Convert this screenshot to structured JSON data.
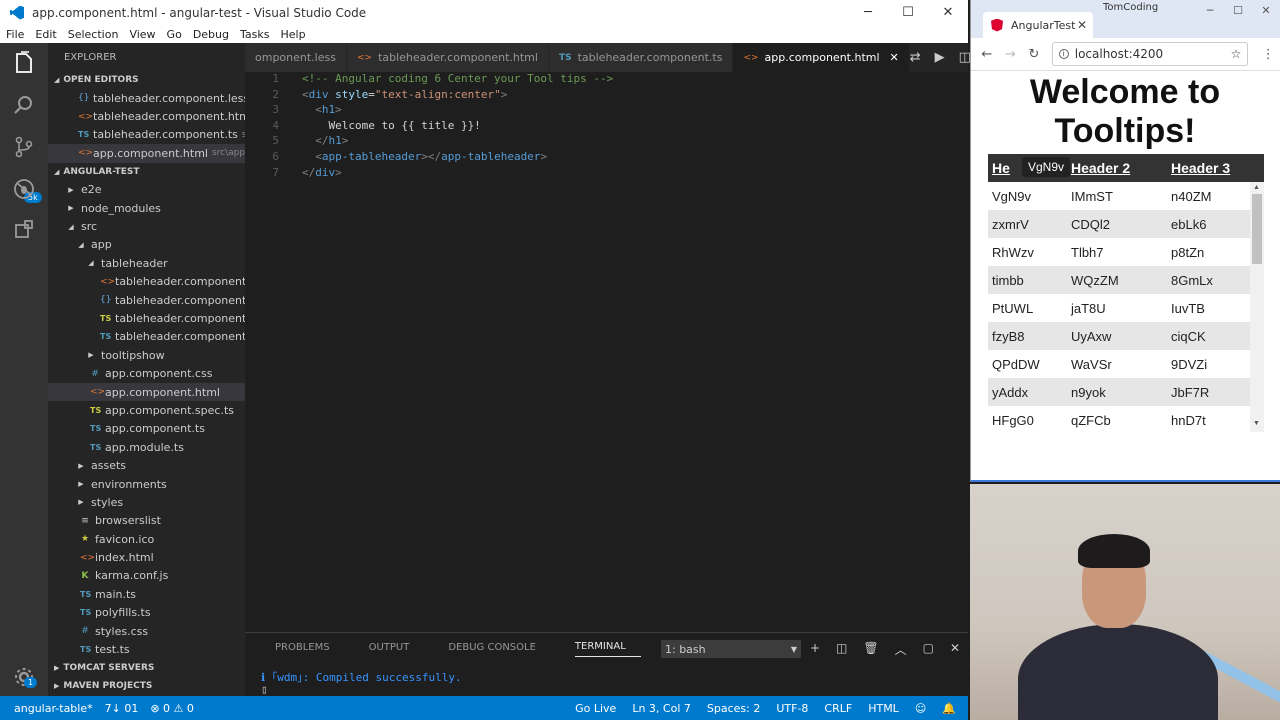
{
  "vscode": {
    "window_title": "app.component.html - angular-test - Visual Studio Code",
    "menu": [
      "File",
      "Edit",
      "Selection",
      "View",
      "Go",
      "Debug",
      "Tasks",
      "Help"
    ],
    "activity_badge": "5k",
    "settings_badge": "1",
    "explorer_title": "EXPLORER",
    "open_editors_label": "OPEN EDITORS",
    "open_editors": [
      {
        "name": "tableheader.component.less",
        "path": "s...",
        "icon": "less-icon"
      },
      {
        "name": "tableheader.component.html",
        "path": "...",
        "icon": "html-icon"
      },
      {
        "name": "tableheader.component.ts",
        "path": "src...",
        "icon": "ts-icon"
      },
      {
        "name": "app.component.html",
        "path": "src\\app",
        "icon": "html-icon"
      }
    ],
    "project_label": "ANGULAR-TEST",
    "tree": [
      {
        "name": "e2e",
        "type": "folder-collapsed"
      },
      {
        "name": "node_modules",
        "type": "folder-collapsed"
      },
      {
        "name": "src",
        "type": "folder-expanded"
      },
      {
        "name": "app",
        "type": "folder-expanded"
      },
      {
        "name": "tableheader",
        "type": "folder-expanded"
      },
      {
        "name": "tableheader.component.html",
        "type": "html"
      },
      {
        "name": "tableheader.component.less",
        "type": "less"
      },
      {
        "name": "tableheader.component.spe...",
        "type": "spec"
      },
      {
        "name": "tableheader.component.ts",
        "type": "ts"
      },
      {
        "name": "tooltipshow",
        "type": "folder-collapsed"
      },
      {
        "name": "app.component.css",
        "type": "css"
      },
      {
        "name": "app.component.html",
        "type": "html"
      },
      {
        "name": "app.component.spec.ts",
        "type": "spec"
      },
      {
        "name": "app.component.ts",
        "type": "ts"
      },
      {
        "name": "app.module.ts",
        "type": "ts"
      },
      {
        "name": "assets",
        "type": "folder-collapsed"
      },
      {
        "name": "environments",
        "type": "folder-collapsed"
      },
      {
        "name": "styles",
        "type": "folder-collapsed"
      },
      {
        "name": "browserslist",
        "type": "plain"
      },
      {
        "name": "favicon.ico",
        "type": "star"
      },
      {
        "name": "index.html",
        "type": "html"
      },
      {
        "name": "karma.conf.js",
        "type": "karma"
      },
      {
        "name": "main.ts",
        "type": "ts"
      },
      {
        "name": "polyfills.ts",
        "type": "ts"
      },
      {
        "name": "styles.css",
        "type": "css"
      },
      {
        "name": "test.ts",
        "type": "ts"
      }
    ],
    "bottom_sections": [
      "TOMCAT SERVERS",
      "MAVEN PROJECTS"
    ],
    "tabs": [
      {
        "label": "omponent.less",
        "icon": ""
      },
      {
        "label": "tableheader.component.html",
        "icon": "<>"
      },
      {
        "label": "tableheader.component.ts",
        "icon": "TS"
      },
      {
        "label": "app.component.html",
        "icon": "<>",
        "active": true
      }
    ],
    "code": [
      {
        "ln": "1",
        "tokens": [
          {
            "t": "<!-- Angular coding 6 Center your Tool tips -->",
            "c": "c-comment"
          }
        ]
      },
      {
        "ln": "2",
        "tokens": [
          {
            "t": "<",
            "c": "c-punct"
          },
          {
            "t": "div",
            "c": "c-tag"
          },
          {
            "t": " style",
            "c": "c-attr"
          },
          {
            "t": "=",
            "c": "c-text"
          },
          {
            "t": "\"text-align:center\"",
            "c": "c-str"
          },
          {
            "t": ">",
            "c": "c-punct"
          }
        ]
      },
      {
        "ln": "3",
        "tokens": [
          {
            "t": "  <",
            "c": "c-punct"
          },
          {
            "t": "h1",
            "c": "c-tag"
          },
          {
            "t": ">",
            "c": "c-punct"
          }
        ]
      },
      {
        "ln": "4",
        "tokens": [
          {
            "t": "    Welcome to {{ title }}!",
            "c": "c-text"
          }
        ]
      },
      {
        "ln": "5",
        "tokens": [
          {
            "t": "  </",
            "c": "c-punct"
          },
          {
            "t": "h1",
            "c": "c-tag"
          },
          {
            "t": ">",
            "c": "c-punct"
          }
        ]
      },
      {
        "ln": "6",
        "tokens": [
          {
            "t": "  <",
            "c": "c-punct"
          },
          {
            "t": "app-tableheader",
            "c": "c-tag"
          },
          {
            "t": "></",
            "c": "c-punct"
          },
          {
            "t": "app-tableheader",
            "c": "c-tag"
          },
          {
            "t": ">",
            "c": "c-punct"
          }
        ]
      },
      {
        "ln": "7",
        "tokens": [
          {
            "t": "</",
            "c": "c-punct"
          },
          {
            "t": "div",
            "c": "c-tag"
          },
          {
            "t": ">",
            "c": "c-punct"
          }
        ]
      }
    ],
    "panel_tabs": [
      "PROBLEMS",
      "OUTPUT",
      "DEBUG CONSOLE",
      "TERMINAL"
    ],
    "terminal_select": "1: bash",
    "terminal_output": "ℹ ｢wdm｣: Compiled successfully.",
    "status": {
      "branch": "angular-table*",
      "sync": "7↓ 01",
      "errors": "⊗ 0 ⚠ 0",
      "go_live": "Go Live",
      "position": "Ln 3, Col 7",
      "spaces": "Spaces: 2",
      "encoding": "UTF-8",
      "eol": "CRLF",
      "language": "HTML"
    }
  },
  "chrome": {
    "tab_title": "AngularTest",
    "profile": "TomCoding",
    "url": "localhost:4200",
    "heading": "Welcome to Tooltips!",
    "headers": [
      "He",
      "Header 2",
      "Header 3"
    ],
    "tooltip": "VgN9v",
    "rows": [
      [
        "VgN9v",
        "IMmST",
        "n40ZM"
      ],
      [
        "zxmrV",
        "CDQl2",
        "ebLk6"
      ],
      [
        "RhWzv",
        "Tlbh7",
        "p8tZn"
      ],
      [
        "timbb",
        "WQzZM",
        "8GmLx"
      ],
      [
        "PtUWL",
        "jaT8U",
        "IuvTB"
      ],
      [
        "fzyB8",
        "UyAxw",
        "ciqCK"
      ],
      [
        "QPdDW",
        "WaVSr",
        "9DVZi"
      ],
      [
        "yAddx",
        "n9yok",
        "JbF7R"
      ],
      [
        "HFgG0",
        "qZFCb",
        "hnD7t"
      ]
    ]
  }
}
